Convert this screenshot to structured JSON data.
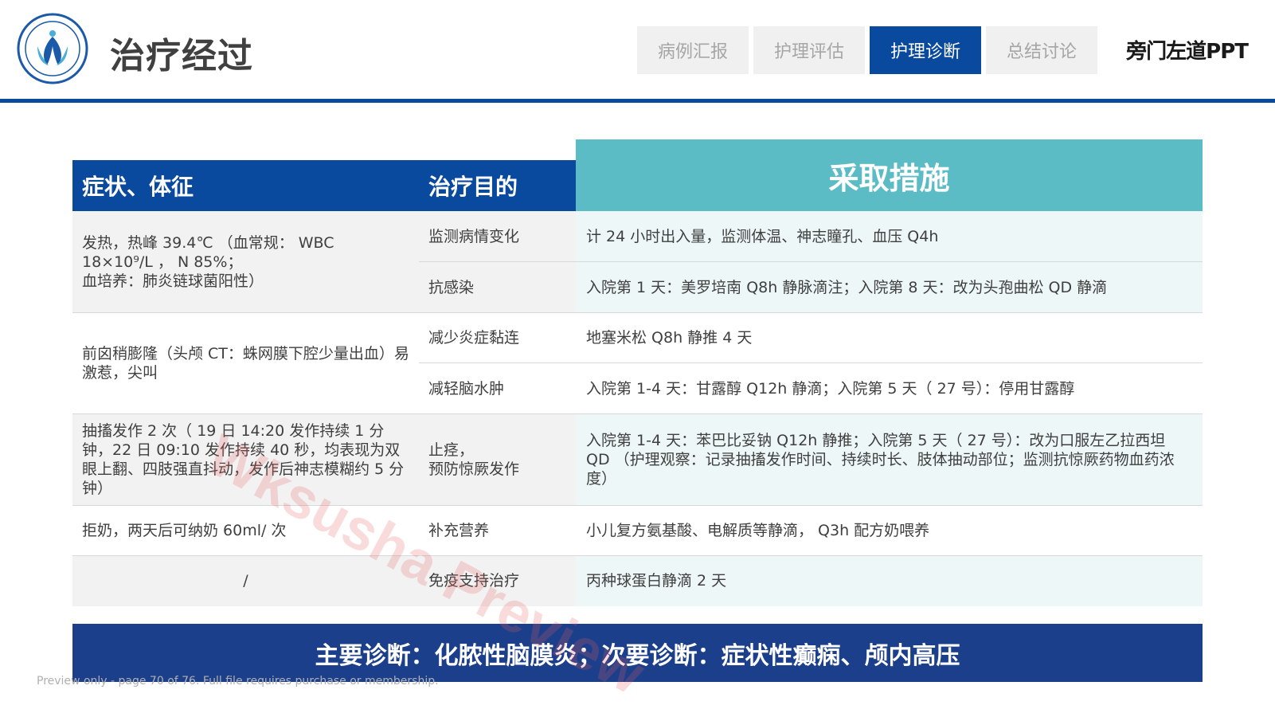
{
  "header": {
    "title": "治疗经过",
    "tabs": [
      {
        "label": "病例汇报",
        "active": false
      },
      {
        "label": "护理评估",
        "active": false
      },
      {
        "label": "护理诊断",
        "active": true
      },
      {
        "label": "总结讨论",
        "active": false
      }
    ],
    "brand": "旁门左道PPT"
  },
  "table": {
    "headers": {
      "symptoms": "症状、体征",
      "purpose": "治疗目的",
      "measures": "采取措施"
    },
    "symptoms": [
      "发热，热峰 39.4℃ （血常规： WBC 18×10⁹/L ， N 85%；\n血培养：肺炎链球菌阳性）",
      "前囟稍膨隆（头颅 CT：蛛网膜下腔少量出血）易激惹，尖叫",
      "抽搐发作 2 次（ 19 日 14:20 发作持续 1 分钟，22 日 09:10 发作持续 40 秒，均表现为双眼上翻、四肢强直抖动，发作后神志模糊约 5 分钟）",
      "拒奶，两天后可纳奶 60ml/ 次",
      "/"
    ],
    "rows": [
      {
        "purpose": "监测病情变化",
        "measure": "计 24 小时出入量，监测体温、神志瞳孔、血压 Q4h"
      },
      {
        "purpose": "抗感染",
        "measure": "入院第 1 天：美罗培南 Q8h 静脉滴注；入院第 8 天：改为头孢曲松 QD 静滴"
      },
      {
        "purpose": "减少炎症黏连",
        "measure": "地塞米松 Q8h 静推 4 天"
      },
      {
        "purpose": "减轻脑水肿",
        "measure": "入院第 1-4 天：甘露醇 Q12h 静滴；入院第 5 天（ 27 号）：停用甘露醇"
      },
      {
        "purpose": "止痉，\n预防惊厥发作",
        "measure": "入院第 1-4 天：苯巴比妥钠 Q12h 静推；入院第 5 天（ 27 号）：改为口服左乙拉西坦 QD （护理观察：记录抽搐发作时间、持续时长、肢体抽动部位；监测抗惊厥药物血药浓度）"
      },
      {
        "purpose": "补充营养",
        "measure": "小儿复方氨基酸、电解质等静滴， Q3h 配方奶喂养"
      },
      {
        "purpose": "免疫支持治疗",
        "measure": "丙种球蛋白静滴 2 天"
      }
    ]
  },
  "diagnosis": "主要诊断：化脓性脑膜炎；次要诊断：症状性癫痫、颅内高压",
  "footer": "Preview only - page 70 of 76. Full file requires purchase or membership.",
  "watermark": "Wksusha Preview",
  "colors": {
    "primary": "#0a4a9e",
    "teal": "#5cbcc5",
    "diagnosis_bar": "#1c3f8c"
  }
}
